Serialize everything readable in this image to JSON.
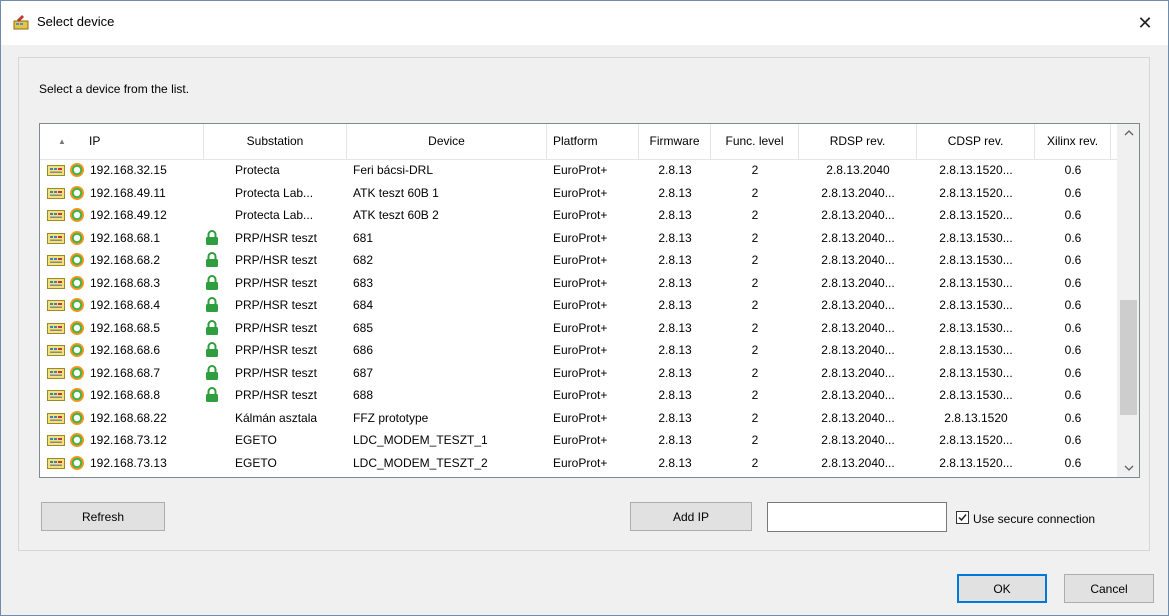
{
  "window": {
    "title": "Select device",
    "close": "✕"
  },
  "prompt": "Select a device from the list.",
  "columns": [
    "IP",
    "Substation",
    "Device",
    "Platform",
    "Firmware",
    "Func. level",
    "RDSP rev.",
    "CDSP rev.",
    "Xilinx rev."
  ],
  "rows": [
    {
      "ip": "192.168.32.15",
      "locked": false,
      "substation": "Protecta",
      "device": "Feri bácsi-DRL",
      "platform": "EuroProt+",
      "firmware": "2.8.13",
      "func": "2",
      "rdsp": "2.8.13.2040",
      "cdsp": "2.8.13.1520...",
      "xilinx": "0.6"
    },
    {
      "ip": "192.168.49.11",
      "locked": false,
      "substation": "Protecta Lab...",
      "device": "ATK teszt 60B 1",
      "platform": "EuroProt+",
      "firmware": "2.8.13",
      "func": "2",
      "rdsp": "2.8.13.2040...",
      "cdsp": "2.8.13.1520...",
      "xilinx": "0.6"
    },
    {
      "ip": "192.168.49.12",
      "locked": false,
      "substation": "Protecta Lab...",
      "device": "ATK teszt 60B 2",
      "platform": "EuroProt+",
      "firmware": "2.8.13",
      "func": "2",
      "rdsp": "2.8.13.2040...",
      "cdsp": "2.8.13.1520...",
      "xilinx": "0.6"
    },
    {
      "ip": "192.168.68.1",
      "locked": true,
      "substation": "PRP/HSR teszt",
      "device": "681",
      "platform": "EuroProt+",
      "firmware": "2.8.13",
      "func": "2",
      "rdsp": "2.8.13.2040...",
      "cdsp": "2.8.13.1530...",
      "xilinx": "0.6"
    },
    {
      "ip": "192.168.68.2",
      "locked": true,
      "substation": "PRP/HSR teszt",
      "device": "682",
      "platform": "EuroProt+",
      "firmware": "2.8.13",
      "func": "2",
      "rdsp": "2.8.13.2040...",
      "cdsp": "2.8.13.1530...",
      "xilinx": "0.6"
    },
    {
      "ip": "192.168.68.3",
      "locked": true,
      "substation": "PRP/HSR teszt",
      "device": "683",
      "platform": "EuroProt+",
      "firmware": "2.8.13",
      "func": "2",
      "rdsp": "2.8.13.2040...",
      "cdsp": "2.8.13.1530...",
      "xilinx": "0.6"
    },
    {
      "ip": "192.168.68.4",
      "locked": true,
      "substation": "PRP/HSR teszt",
      "device": "684",
      "platform": "EuroProt+",
      "firmware": "2.8.13",
      "func": "2",
      "rdsp": "2.8.13.2040...",
      "cdsp": "2.8.13.1530...",
      "xilinx": "0.6"
    },
    {
      "ip": "192.168.68.5",
      "locked": true,
      "substation": "PRP/HSR teszt",
      "device": "685",
      "platform": "EuroProt+",
      "firmware": "2.8.13",
      "func": "2",
      "rdsp": "2.8.13.2040...",
      "cdsp": "2.8.13.1530...",
      "xilinx": "0.6"
    },
    {
      "ip": "192.168.68.6",
      "locked": true,
      "substation": "PRP/HSR teszt",
      "device": "686",
      "platform": "EuroProt+",
      "firmware": "2.8.13",
      "func": "2",
      "rdsp": "2.8.13.2040...",
      "cdsp": "2.8.13.1530...",
      "xilinx": "0.6"
    },
    {
      "ip": "192.168.68.7",
      "locked": true,
      "substation": "PRP/HSR teszt",
      "device": "687",
      "platform": "EuroProt+",
      "firmware": "2.8.13",
      "func": "2",
      "rdsp": "2.8.13.2040...",
      "cdsp": "2.8.13.1530...",
      "xilinx": "0.6"
    },
    {
      "ip": "192.168.68.8",
      "locked": true,
      "substation": "PRP/HSR teszt",
      "device": "688",
      "platform": "EuroProt+",
      "firmware": "2.8.13",
      "func": "2",
      "rdsp": "2.8.13.2040...",
      "cdsp": "2.8.13.1530...",
      "xilinx": "0.6"
    },
    {
      "ip": "192.168.68.22",
      "locked": false,
      "substation": "Kálmán asztala",
      "device": "FFZ prototype",
      "platform": "EuroProt+",
      "firmware": "2.8.13",
      "func": "2",
      "rdsp": "2.8.13.2040...",
      "cdsp": "2.8.13.1520",
      "xilinx": "0.6"
    },
    {
      "ip": "192.168.73.12",
      "locked": false,
      "substation": "EGETO",
      "device": "LDC_MODEM_TESZT_1",
      "platform": "EuroProt+",
      "firmware": "2.8.13",
      "func": "2",
      "rdsp": "2.8.13.2040...",
      "cdsp": "2.8.13.1520...",
      "xilinx": "0.6"
    },
    {
      "ip": "192.168.73.13",
      "locked": false,
      "substation": "EGETO",
      "device": "LDC_MODEM_TESZT_2",
      "platform": "EuroProt+",
      "firmware": "2.8.13",
      "func": "2",
      "rdsp": "2.8.13.2040...",
      "cdsp": "2.8.13.1520...",
      "xilinx": "0.6"
    }
  ],
  "buttons": {
    "refresh": "Refresh",
    "add_ip": "Add IP",
    "ok": "OK",
    "cancel": "Cancel"
  },
  "ip_input": {
    "value": "",
    "placeholder": ""
  },
  "secure": {
    "label": "Use secure connection",
    "checked": true
  },
  "icons": {
    "device": "device-module-icon",
    "status": "status-ring-icon",
    "lock": "lock-icon"
  },
  "colors": {
    "accent": "#0078d7",
    "status_green": "#39b54a",
    "status_orange": "#f7941d",
    "lock_green": "#2e9e3e"
  }
}
